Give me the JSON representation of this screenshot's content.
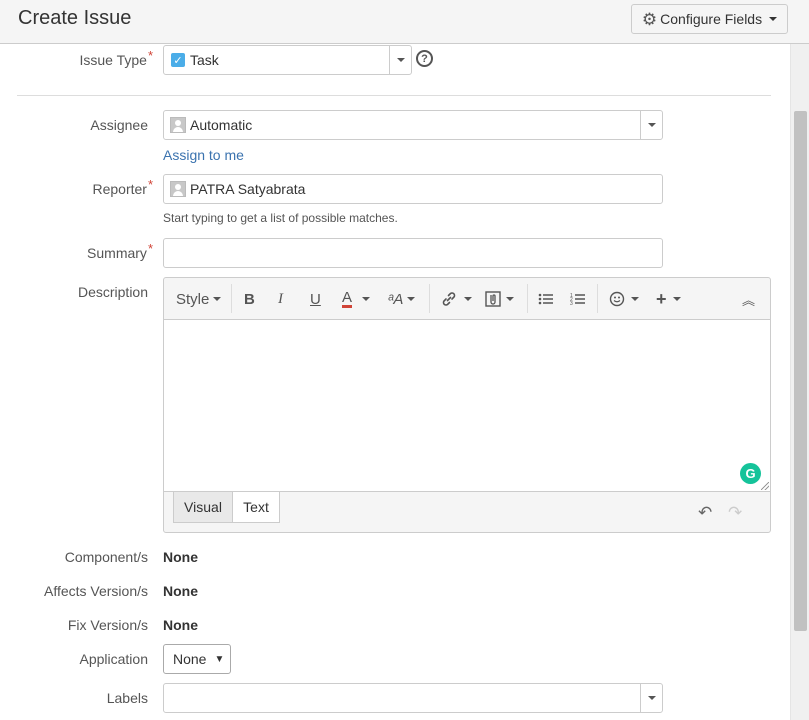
{
  "header": {
    "title": "Create Issue",
    "configure_label": "Configure Fields"
  },
  "issue_type": {
    "label": "Issue Type",
    "value": "Task",
    "required": "*"
  },
  "assignee": {
    "label": "Assignee",
    "value": "Automatic",
    "assign_link": "Assign to me"
  },
  "reporter": {
    "label": "Reporter",
    "value": "PATRA Satyabrata",
    "required": "*",
    "hint": "Start typing to get a list of possible matches."
  },
  "summary": {
    "label": "Summary",
    "required": "*",
    "value": ""
  },
  "description": {
    "label": "Description",
    "toolbar": {
      "style_label": "Style",
      "bold": "B",
      "italic": "I",
      "underline": "U",
      "text_color": "A"
    },
    "tabs": {
      "visual": "Visual",
      "text": "Text"
    },
    "active_tab": "Text"
  },
  "components": {
    "label": "Component/s",
    "value": "None"
  },
  "affects_versions": {
    "label": "Affects Version/s",
    "value": "None"
  },
  "fix_versions": {
    "label": "Fix Version/s",
    "value": "None"
  },
  "application": {
    "label": "Application",
    "value": "None"
  },
  "labels": {
    "label": "Labels",
    "value": ""
  },
  "colors": {
    "required": "#d04437",
    "link": "#3b73af",
    "task_icon": "#4bade8",
    "grammarly": "#15c39a"
  },
  "icons": [
    "gear-icon",
    "help-icon",
    "task-icon",
    "avatar-icon",
    "grammarly-icon",
    "undo-icon",
    "redo-icon"
  ]
}
